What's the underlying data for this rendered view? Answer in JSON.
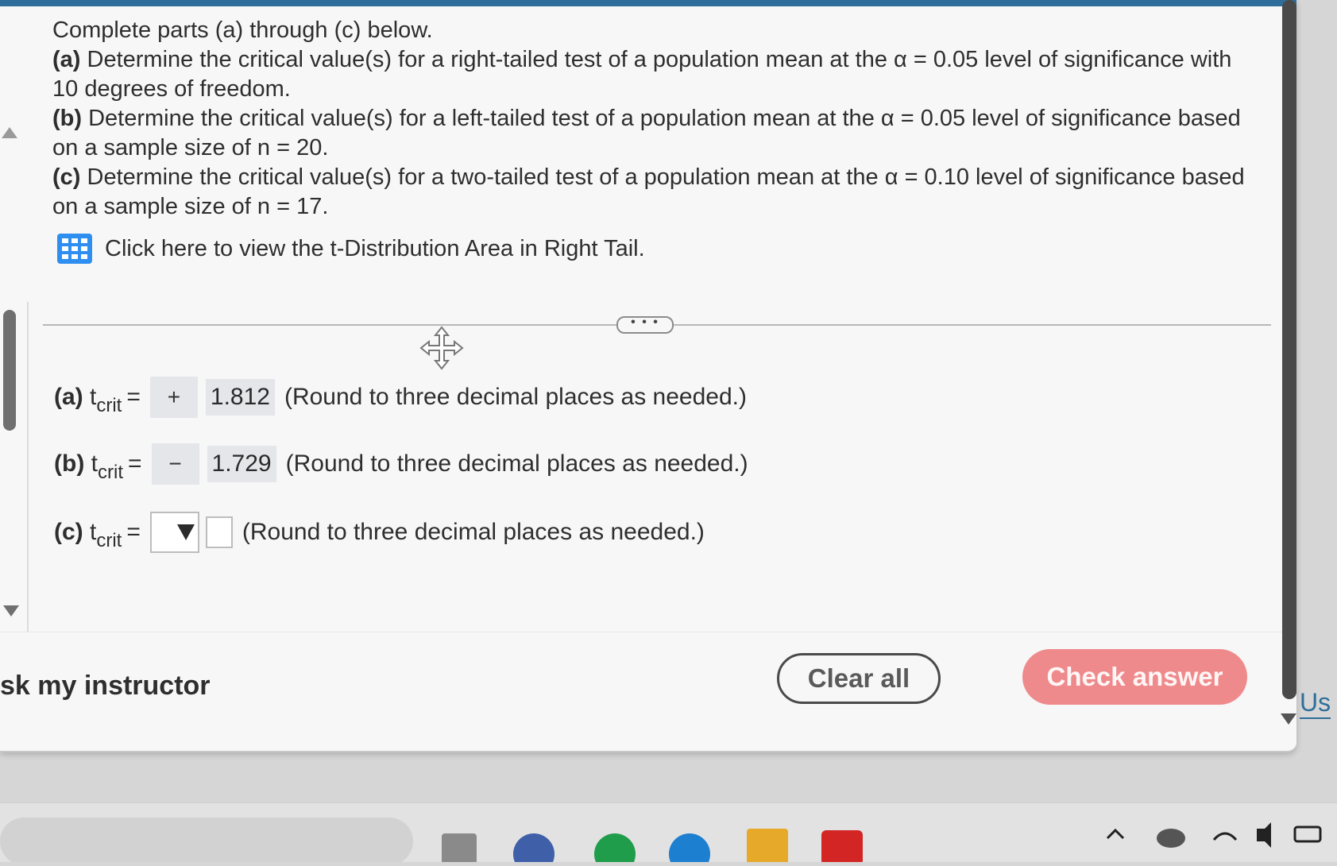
{
  "question": {
    "intro": "Complete parts (a) through (c) below.",
    "part_a_label": "(a)",
    "part_a_text": "Determine the critical value(s) for a right-tailed test of a population mean at the α = 0.05 level of significance with 10 degrees of freedom.",
    "part_b_label": "(b)",
    "part_b_text": "Determine the critical value(s) for a left-tailed test of a population mean at the α = 0.05 level  of significance based on a sample size of n = 20.",
    "part_c_label": "(c)",
    "part_c_text": "Determine the critical value(s) for a two-tailed test of a population mean at the α = 0.10 level of significance based on a sample size of n = 17.",
    "table_link": "Click here to view the t-Distribution Area in Right Tail.",
    "table_icon": "grid-table-icon"
  },
  "more_toggle": "• • •",
  "answers": {
    "a": {
      "label": "(a)",
      "var": "t",
      "sub": "crit",
      "eq": "=",
      "sign": "+",
      "value": "1.812",
      "hint": "(Round to three decimal places as needed.)"
    },
    "b": {
      "label": "(b)",
      "var": "t",
      "sub": "crit",
      "eq": "=",
      "sign": "−",
      "value": "1.729",
      "hint": "(Round to three decimal places as needed.)"
    },
    "c": {
      "label": "(c)",
      "var": "t",
      "sub": "crit",
      "eq": "=",
      "sign": "",
      "value": "",
      "hint": "(Round to three decimal places as needed.)"
    }
  },
  "footer": {
    "ask_instructor": "sk my instructor",
    "clear_all": "Clear all",
    "check_answer": "Check answer",
    "right_fragment": "Us"
  },
  "colors": {
    "accent_blue": "#2f8ff0",
    "check_answer_bg": "#ef8a8c",
    "answer_box_bg": "#e4e6ea"
  }
}
